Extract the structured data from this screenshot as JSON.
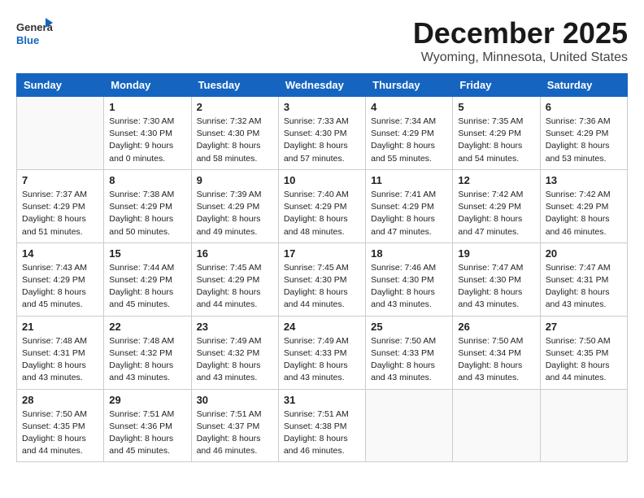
{
  "header": {
    "logo_line1": "General",
    "logo_line2": "Blue",
    "month": "December 2025",
    "location": "Wyoming, Minnesota, United States"
  },
  "weekdays": [
    "Sunday",
    "Monday",
    "Tuesday",
    "Wednesday",
    "Thursday",
    "Friday",
    "Saturday"
  ],
  "weeks": [
    [
      {
        "day": "",
        "info": ""
      },
      {
        "day": "1",
        "info": "Sunrise: 7:30 AM\nSunset: 4:30 PM\nDaylight: 9 hours\nand 0 minutes."
      },
      {
        "day": "2",
        "info": "Sunrise: 7:32 AM\nSunset: 4:30 PM\nDaylight: 8 hours\nand 58 minutes."
      },
      {
        "day": "3",
        "info": "Sunrise: 7:33 AM\nSunset: 4:30 PM\nDaylight: 8 hours\nand 57 minutes."
      },
      {
        "day": "4",
        "info": "Sunrise: 7:34 AM\nSunset: 4:29 PM\nDaylight: 8 hours\nand 55 minutes."
      },
      {
        "day": "5",
        "info": "Sunrise: 7:35 AM\nSunset: 4:29 PM\nDaylight: 8 hours\nand 54 minutes."
      },
      {
        "day": "6",
        "info": "Sunrise: 7:36 AM\nSunset: 4:29 PM\nDaylight: 8 hours\nand 53 minutes."
      }
    ],
    [
      {
        "day": "7",
        "info": "Sunrise: 7:37 AM\nSunset: 4:29 PM\nDaylight: 8 hours\nand 51 minutes."
      },
      {
        "day": "8",
        "info": "Sunrise: 7:38 AM\nSunset: 4:29 PM\nDaylight: 8 hours\nand 50 minutes."
      },
      {
        "day": "9",
        "info": "Sunrise: 7:39 AM\nSunset: 4:29 PM\nDaylight: 8 hours\nand 49 minutes."
      },
      {
        "day": "10",
        "info": "Sunrise: 7:40 AM\nSunset: 4:29 PM\nDaylight: 8 hours\nand 48 minutes."
      },
      {
        "day": "11",
        "info": "Sunrise: 7:41 AM\nSunset: 4:29 PM\nDaylight: 8 hours\nand 47 minutes."
      },
      {
        "day": "12",
        "info": "Sunrise: 7:42 AM\nSunset: 4:29 PM\nDaylight: 8 hours\nand 47 minutes."
      },
      {
        "day": "13",
        "info": "Sunrise: 7:42 AM\nSunset: 4:29 PM\nDaylight: 8 hours\nand 46 minutes."
      }
    ],
    [
      {
        "day": "14",
        "info": "Sunrise: 7:43 AM\nSunset: 4:29 PM\nDaylight: 8 hours\nand 45 minutes."
      },
      {
        "day": "15",
        "info": "Sunrise: 7:44 AM\nSunset: 4:29 PM\nDaylight: 8 hours\nand 45 minutes."
      },
      {
        "day": "16",
        "info": "Sunrise: 7:45 AM\nSunset: 4:29 PM\nDaylight: 8 hours\nand 44 minutes."
      },
      {
        "day": "17",
        "info": "Sunrise: 7:45 AM\nSunset: 4:30 PM\nDaylight: 8 hours\nand 44 minutes."
      },
      {
        "day": "18",
        "info": "Sunrise: 7:46 AM\nSunset: 4:30 PM\nDaylight: 8 hours\nand 43 minutes."
      },
      {
        "day": "19",
        "info": "Sunrise: 7:47 AM\nSunset: 4:30 PM\nDaylight: 8 hours\nand 43 minutes."
      },
      {
        "day": "20",
        "info": "Sunrise: 7:47 AM\nSunset: 4:31 PM\nDaylight: 8 hours\nand 43 minutes."
      }
    ],
    [
      {
        "day": "21",
        "info": "Sunrise: 7:48 AM\nSunset: 4:31 PM\nDaylight: 8 hours\nand 43 minutes."
      },
      {
        "day": "22",
        "info": "Sunrise: 7:48 AM\nSunset: 4:32 PM\nDaylight: 8 hours\nand 43 minutes."
      },
      {
        "day": "23",
        "info": "Sunrise: 7:49 AM\nSunset: 4:32 PM\nDaylight: 8 hours\nand 43 minutes."
      },
      {
        "day": "24",
        "info": "Sunrise: 7:49 AM\nSunset: 4:33 PM\nDaylight: 8 hours\nand 43 minutes."
      },
      {
        "day": "25",
        "info": "Sunrise: 7:50 AM\nSunset: 4:33 PM\nDaylight: 8 hours\nand 43 minutes."
      },
      {
        "day": "26",
        "info": "Sunrise: 7:50 AM\nSunset: 4:34 PM\nDaylight: 8 hours\nand 43 minutes."
      },
      {
        "day": "27",
        "info": "Sunrise: 7:50 AM\nSunset: 4:35 PM\nDaylight: 8 hours\nand 44 minutes."
      }
    ],
    [
      {
        "day": "28",
        "info": "Sunrise: 7:50 AM\nSunset: 4:35 PM\nDaylight: 8 hours\nand 44 minutes."
      },
      {
        "day": "29",
        "info": "Sunrise: 7:51 AM\nSunset: 4:36 PM\nDaylight: 8 hours\nand 45 minutes."
      },
      {
        "day": "30",
        "info": "Sunrise: 7:51 AM\nSunset: 4:37 PM\nDaylight: 8 hours\nand 46 minutes."
      },
      {
        "day": "31",
        "info": "Sunrise: 7:51 AM\nSunset: 4:38 PM\nDaylight: 8 hours\nand 46 minutes."
      },
      {
        "day": "",
        "info": ""
      },
      {
        "day": "",
        "info": ""
      },
      {
        "day": "",
        "info": ""
      }
    ]
  ]
}
